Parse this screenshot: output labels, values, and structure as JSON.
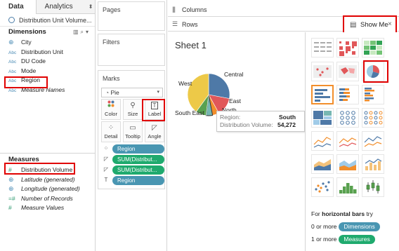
{
  "data_pane": {
    "tabs": [
      "Data",
      "Analytics"
    ],
    "datasource": "Distribution Unit Volume...",
    "dimensions_label": "Dimensions",
    "dimensions": [
      {
        "type": "globe",
        "name": "City",
        "italic": false
      },
      {
        "type": "Abc",
        "name": "Distribution Unit",
        "italic": false
      },
      {
        "type": "Abc",
        "name": "DU Code",
        "italic": false
      },
      {
        "type": "Abc",
        "name": "Mode",
        "italic": false
      },
      {
        "type": "Abc",
        "name": "Region",
        "italic": false
      },
      {
        "type": "Abc",
        "name": "Measure Names",
        "italic": true
      }
    ],
    "measures_label": "Measures",
    "measures": [
      {
        "type": "#",
        "name": "Distribution Volume",
        "italic": false
      },
      {
        "type": "globe",
        "name": "Latitude (generated)",
        "italic": true
      },
      {
        "type": "globe",
        "name": "Longitude (generated)",
        "italic": true
      },
      {
        "type": "=#",
        "name": "Number of Records",
        "italic": true
      },
      {
        "type": "#",
        "name": "Measure Values",
        "italic": true
      }
    ]
  },
  "cards": {
    "pages_label": "Pages",
    "filters_label": "Filters",
    "marks_label": "Marks",
    "mark_type": "Pie",
    "buttons": [
      "Color",
      "Size",
      "Label",
      "Detail",
      "Tooltip",
      "Angle"
    ],
    "pills": [
      {
        "icon": "dots",
        "label": "Region",
        "color": "blue"
      },
      {
        "icon": "angle",
        "label": "SUM(Distribut...",
        "color": "green"
      },
      {
        "icon": "angle",
        "label": "SUM(Distribut...",
        "color": "green"
      },
      {
        "icon": "label",
        "label": "Region",
        "color": "blue"
      }
    ]
  },
  "shelves": {
    "columns_label": "Columns",
    "rows_label": "Rows"
  },
  "view": {
    "title": "Sheet 1",
    "pie_labels": [
      "West",
      "Central",
      "East",
      "North",
      "South East"
    ],
    "slices": [
      {
        "region": "Central",
        "share": 0.28,
        "color": "#4e79a7"
      },
      {
        "region": "East",
        "share": 0.14,
        "color": "#e15759"
      },
      {
        "region": "North",
        "share": 0.05,
        "color": "#f28e2b"
      },
      {
        "region": "South",
        "share": 0.05,
        "color": "#76b7b2"
      },
      {
        "region": "South East",
        "share": 0.08,
        "color": "#59a14f"
      },
      {
        "region": "West",
        "share": 0.4,
        "color": "#edc948"
      }
    ],
    "tooltip": {
      "k1": "Region:",
      "v1": "South",
      "k2": "Distribution Volume:",
      "v2": "54,272"
    }
  },
  "show_me": {
    "title": "Show Me",
    "hint_prefix": "For",
    "hint_bold": "horizontal bars",
    "hint_suffix": "try",
    "req1_prefix": "0 or more",
    "req1_pill": "Dimensions",
    "req2_prefix": "1 or more",
    "req2_pill": "Measures"
  }
}
